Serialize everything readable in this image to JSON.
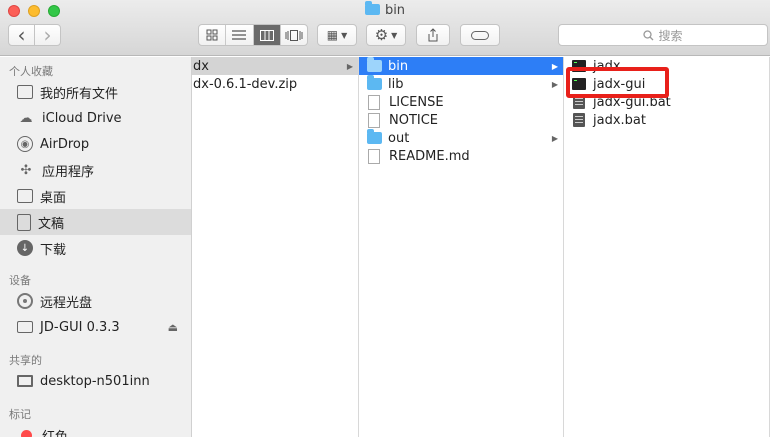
{
  "window": {
    "title": "bin",
    "search_placeholder": "搜索",
    "folder_icon": "folder-icon"
  },
  "toolbar": {
    "back_glyph": "‹",
    "forward_glyph": "›",
    "view_icons": [
      "icon-view-icon",
      "list-view-icon",
      "column-view-icon",
      "coverflow-view-icon"
    ],
    "active_view": "column-view-icon",
    "arrange_glyph": "▦",
    "action_glyph": "⚙",
    "share_glyph": "⬆",
    "search_glyph": "🔍"
  },
  "sidebar": {
    "favorites_header": "个人收藏",
    "favorites": [
      {
        "label": "我的所有文件",
        "icon": "all-files-icon"
      },
      {
        "label": "iCloud Drive",
        "icon": "cloud-icon"
      },
      {
        "label": "AirDrop",
        "icon": "airdrop-icon"
      },
      {
        "label": "应用程序",
        "icon": "applications-icon"
      },
      {
        "label": "桌面",
        "icon": "desktop-icon"
      },
      {
        "label": "文稿",
        "icon": "documents-icon",
        "selected": true
      },
      {
        "label": "下载",
        "icon": "downloads-icon"
      }
    ],
    "devices_header": "设备",
    "devices": [
      {
        "label": "远程光盘",
        "icon": "remote-disc-icon"
      },
      {
        "label": "JD-GUI 0.3.3",
        "icon": "drive-icon",
        "eject": "⏏"
      }
    ],
    "shared_header": "共享的",
    "shared": [
      {
        "label": "desktop-n501inn",
        "icon": "computer-icon"
      }
    ],
    "tags_header": "标记",
    "tags": [
      {
        "label": "红色",
        "color": "#ff4a4a"
      }
    ]
  },
  "columns": {
    "col1": [
      {
        "name": "dx",
        "type": "folder",
        "selected": "gray",
        "has_children": true
      },
      {
        "name": "dx-0.6.1-dev.zip",
        "type": "file"
      }
    ],
    "col2": [
      {
        "name": "bin",
        "type": "folder",
        "selected": "blue",
        "has_children": true
      },
      {
        "name": "lib",
        "type": "folder",
        "has_children": true
      },
      {
        "name": "LICENSE",
        "type": "doc"
      },
      {
        "name": "NOTICE",
        "type": "doc"
      },
      {
        "name": "out",
        "type": "folder",
        "has_children": true
      },
      {
        "name": "README.md",
        "type": "doc"
      }
    ],
    "col3": [
      {
        "name": "jadx",
        "type": "exec"
      },
      {
        "name": "jadx-gui",
        "type": "exec",
        "highlighted": true
      },
      {
        "name": "jadx-gui.bat",
        "type": "bat"
      },
      {
        "name": "jadx.bat",
        "type": "bat"
      }
    ]
  },
  "annotation": {
    "highlight_color": "#e8201a",
    "target": "jadx-gui"
  }
}
